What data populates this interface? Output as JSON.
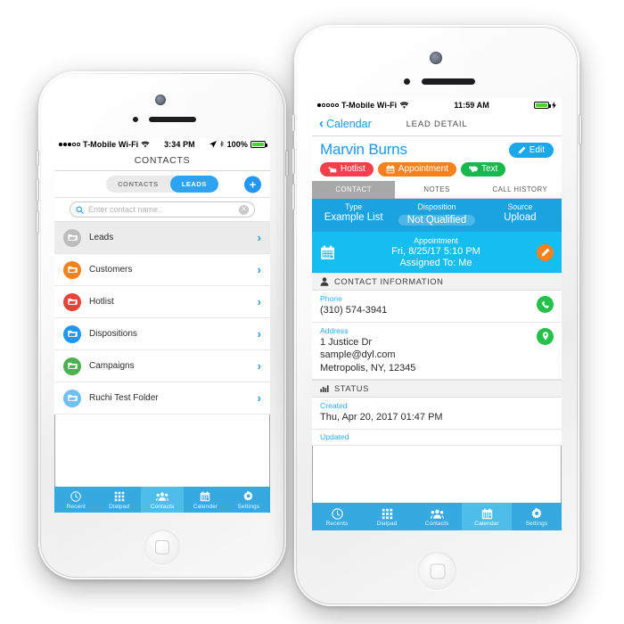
{
  "left_phone": {
    "status_bar": {
      "signal_dots_filled": 3,
      "signal_dots_total": 5,
      "carrier": "T-Mobile Wi-Fi",
      "time": "3:34 PM",
      "battery_percent": "100%",
      "icons": [
        "location-arrow-icon",
        "bluetooth-icon",
        "battery-icon"
      ]
    },
    "navbar_title": "CONTACTS",
    "segmented_control": {
      "options": [
        "CONTACTS",
        "LEADS"
      ],
      "selected": "LEADS"
    },
    "add_button_label": "+",
    "search": {
      "placeholder": "Enter contact name..",
      "value": "",
      "icon": "search-icon",
      "clear_icon": "clear-circle-icon"
    },
    "folders": [
      {
        "label": "Leads",
        "color": "#bdbdbd",
        "selected": true
      },
      {
        "label": "Customers",
        "color": "#f5821f",
        "selected": false
      },
      {
        "label": "Hotlist",
        "color": "#e8423a",
        "selected": false
      },
      {
        "label": "Dispositions",
        "color": "#2196f3",
        "selected": false
      },
      {
        "label": "Campaigns",
        "color": "#4caf50",
        "selected": false
      },
      {
        "label": "Ruchi Test Folder",
        "color": "#6ec1ef",
        "selected": false
      }
    ],
    "tabs": [
      {
        "label": "Recent",
        "icon": "clock-icon",
        "active": false
      },
      {
        "label": "Dialpad",
        "icon": "grid-icon",
        "active": false
      },
      {
        "label": "Contacts",
        "icon": "people-icon",
        "active": true
      },
      {
        "label": "Calender",
        "icon": "calendar-icon",
        "active": false
      },
      {
        "label": "Settings",
        "icon": "gear-icon",
        "active": false
      }
    ]
  },
  "right_phone": {
    "status_bar": {
      "signal_dots_filled": 1,
      "signal_dots_total": 5,
      "carrier": "T-Mobile Wi-Fi",
      "time": "11:59 AM",
      "icons": [
        "battery-icon",
        "charging-bolt-icon"
      ]
    },
    "navbar": {
      "back_label": "Calendar",
      "title": "LEAD DETAIL"
    },
    "contact_name": "Marvin Burns",
    "edit_button_label": "Edit",
    "action_chips": [
      {
        "label": "Hotlist",
        "color": "#f5404a",
        "icon": "add-folder-icon"
      },
      {
        "label": "Appointment",
        "color": "#f5821f",
        "icon": "calendar-icon"
      },
      {
        "label": "Text",
        "color": "#19b84c",
        "icon": "chat-icon"
      }
    ],
    "detail_tabs": [
      {
        "label": "CONTACT",
        "active": true
      },
      {
        "label": "NOTES",
        "active": false
      },
      {
        "label": "CALL HISTORY",
        "active": false
      }
    ],
    "summary": [
      {
        "key": "Type",
        "value": "Example List",
        "pill": false
      },
      {
        "key": "Disposition",
        "value": "Not Qualified",
        "pill": true
      },
      {
        "key": "Source",
        "value": "Upload",
        "pill": false
      }
    ],
    "appointment": {
      "title": "Appointment",
      "datetime": "Fri, 8/25/17 5:10 PM",
      "assigned": "Assigned To: Me",
      "icon": "calendar-icon",
      "edit_icon": "pencil-icon"
    },
    "contact_information": {
      "section_title": "CONTACT INFORMATION",
      "section_icon": "person-icon",
      "fields": [
        {
          "key": "Phone",
          "value": "(310) 574-3941",
          "action_icon": "phone-icon",
          "action_color": "#24c04a"
        },
        {
          "key": "Address",
          "value": "1 Justice Dr\nsample@dyl.com\nMetropolis, NY, 12345",
          "action_icon": "map-pin-icon",
          "action_color": "#24c04a"
        }
      ]
    },
    "status_section": {
      "section_title": "STATUS",
      "section_icon": "bar-chart-icon",
      "fields": [
        {
          "key": "Created",
          "value": "Thu, Apr 20, 2017 01:47 PM"
        },
        {
          "key": "Updated",
          "value": ""
        }
      ]
    },
    "tabs": [
      {
        "label": "Recents",
        "icon": "clock-icon",
        "active": false
      },
      {
        "label": "Dialpad",
        "icon": "grid-icon",
        "active": false
      },
      {
        "label": "Contacts",
        "icon": "people-icon",
        "active": false
      },
      {
        "label": "Calendar",
        "icon": "calendar-icon",
        "active": true
      },
      {
        "label": "Settings",
        "icon": "gear-icon",
        "active": false
      }
    ]
  },
  "theme": {
    "tabbar_blue": "#36a9e1",
    "tabbar_active_blue": "#4fbdea",
    "summary_blue": "#1ba3e0",
    "appointment_cyan": "#16bdf0",
    "link_blue": "#2196f3",
    "orange": "#f5821f",
    "green": "#24c04a",
    "red": "#e8423a"
  }
}
